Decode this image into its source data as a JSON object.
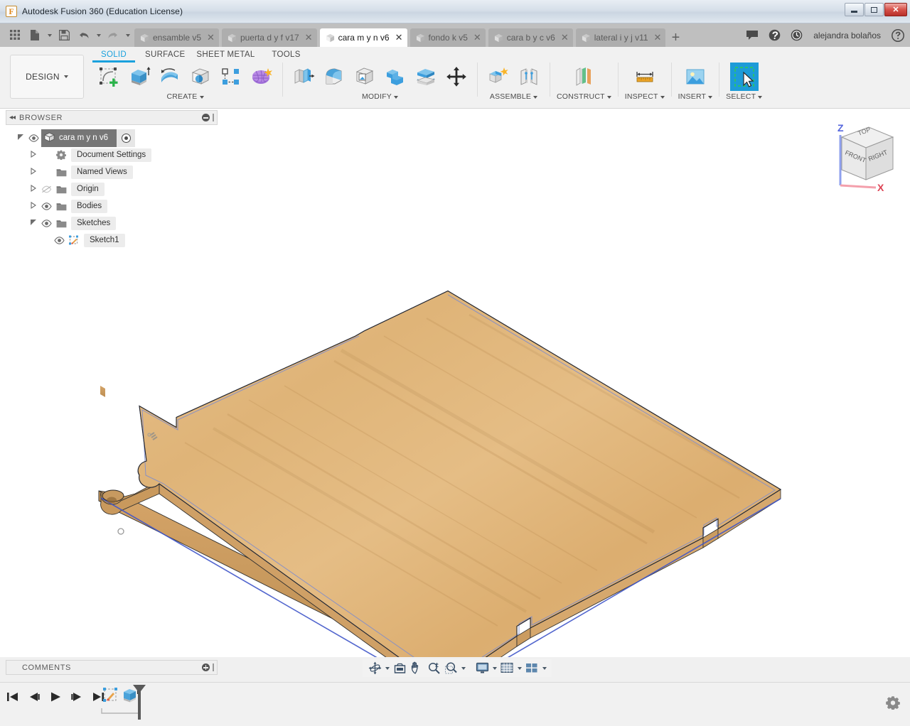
{
  "window": {
    "title": "Autodesk Fusion 360 (Education License)",
    "logo_letter": "F",
    "controls": {
      "minimize": "minimize-button",
      "maximize": "maximize-button",
      "close": "✕"
    }
  },
  "quick_access": [
    {
      "name": "app-grid-icon",
      "label": "Show Data Panel"
    },
    {
      "name": "file-icon",
      "label": "File",
      "has_caret": true
    },
    {
      "name": "save-icon",
      "label": "Save"
    },
    {
      "name": "undo-icon",
      "label": "Undo",
      "has_caret": true
    },
    {
      "name": "redo-icon",
      "label": "Redo",
      "has_caret": true
    }
  ],
  "document_tabs": [
    {
      "label": "ensamble v5",
      "active": false,
      "close": "✕"
    },
    {
      "label": "puerta d y f v17",
      "active": false,
      "close": "✕"
    },
    {
      "label": "cara m y n v6",
      "active": true,
      "close": "✕"
    },
    {
      "label": "fondo k v5",
      "active": false,
      "close": "✕"
    },
    {
      "label": "cara b y c v6",
      "active": false,
      "close": "✕"
    },
    {
      "label": "lateral i y j v11",
      "active": false,
      "close": "✕"
    }
  ],
  "new_tab_label": "+",
  "titlebar_right": {
    "user_name": "alejandra bolaños",
    "icons": [
      "chat-icon",
      "notifications-icon",
      "job-status-icon",
      "help-icon"
    ]
  },
  "ribbon": {
    "workspace_button": "DESIGN",
    "tabs": [
      {
        "label": "SOLID",
        "active": true
      },
      {
        "label": "SURFACE",
        "active": false
      },
      {
        "label": "SHEET METAL",
        "active": false
      },
      {
        "label": "TOOLS",
        "active": false
      }
    ],
    "groups": [
      {
        "label": "CREATE",
        "has_caret": true,
        "icons": [
          "create-sketch-icon",
          "extrude-icon",
          "revolve-icon",
          "sphere-icon",
          "pattern-icon",
          "form-icon"
        ]
      },
      {
        "label": "MODIFY",
        "has_caret": true,
        "icons": [
          "press-pull-icon",
          "fillet-icon",
          "shell-icon",
          "combine-icon",
          "split-face-icon",
          "move-copy-icon"
        ]
      },
      {
        "label": "ASSEMBLE",
        "has_caret": true,
        "icons": [
          "new-component-icon",
          "joint-icon"
        ]
      },
      {
        "label": "CONSTRUCT",
        "has_caret": true,
        "icons": [
          "offset-plane-icon"
        ]
      },
      {
        "label": "INSPECT",
        "has_caret": true,
        "icons": [
          "measure-icon"
        ]
      },
      {
        "label": "INSERT",
        "has_caret": true,
        "icons": [
          "insert-image-icon"
        ]
      },
      {
        "label": "SELECT",
        "has_caret": true,
        "selected": true,
        "icons": [
          "select-window-icon"
        ]
      }
    ]
  },
  "browser": {
    "panel_title": "BROWSER",
    "collapse_icon": "◂◂",
    "tree": [
      {
        "label": "cara m y n v6",
        "depth": 0,
        "twist": "expanded",
        "eye": true,
        "icon": "component-cube-icon",
        "root": true,
        "radio": true
      },
      {
        "label": "Document Settings",
        "depth": 1,
        "twist": "collapsed",
        "eye": false,
        "icon": "gear-icon"
      },
      {
        "label": "Named Views",
        "depth": 1,
        "twist": "collapsed",
        "eye": false,
        "icon": "folder-icon"
      },
      {
        "label": "Origin",
        "depth": 1,
        "twist": "collapsed",
        "eye": "off",
        "icon": "folder-icon"
      },
      {
        "label": "Bodies",
        "depth": 1,
        "twist": "collapsed",
        "eye": true,
        "icon": "folder-icon"
      },
      {
        "label": "Sketches",
        "depth": 1,
        "twist": "expanded",
        "eye": true,
        "icon": "folder-icon"
      },
      {
        "label": "Sketch1",
        "depth": 2,
        "twist": "none",
        "eye": true,
        "icon": "sketch-icon"
      }
    ]
  },
  "comments": {
    "panel_title": "COMMENTS",
    "add_icon": "add-comment-icon"
  },
  "viewcube": {
    "faces": {
      "top": "TOP",
      "front": "FRONT",
      "right": "RIGHT"
    },
    "axes": {
      "z": "Z",
      "x": "X"
    }
  },
  "navbar": {
    "buttons": [
      {
        "name": "orbit-icon",
        "caret": true
      },
      {
        "name": "look-at-icon",
        "caret": false
      },
      {
        "name": "pan-icon",
        "caret": false
      },
      {
        "name": "zoom-icon",
        "caret": false
      },
      {
        "name": "zoom-window-icon",
        "caret": true
      },
      {
        "name": "display-settings-icon",
        "caret": true
      },
      {
        "name": "grid-snaps-icon",
        "caret": true
      },
      {
        "name": "viewports-icon",
        "caret": true
      }
    ]
  },
  "timeline": {
    "controls": [
      "go-to-beginning-icon",
      "step-back-icon",
      "play-icon",
      "step-forward-icon",
      "go-to-end-icon"
    ],
    "features": [
      {
        "name": "sketch1-feature-icon",
        "label": "Sketch1"
      },
      {
        "name": "extrude-feature-icon",
        "label": "Extrude1"
      }
    ],
    "settings_icon": "gear-icon"
  },
  "model": {
    "description": "wooden panel body",
    "face_color": "#e2b77e",
    "edge_color": "#6a7ec8",
    "side_color": "#c9a067",
    "background": "#ffffff",
    "holes": 2,
    "sketch_points": 2
  },
  "colors": {
    "accent": "#1aa1dd",
    "selection": "#1d9bd8",
    "ribbon_bg": "#f1f1f1",
    "tabstrip_bg": "#bfbfbf",
    "tree_highlight": "#767676"
  }
}
